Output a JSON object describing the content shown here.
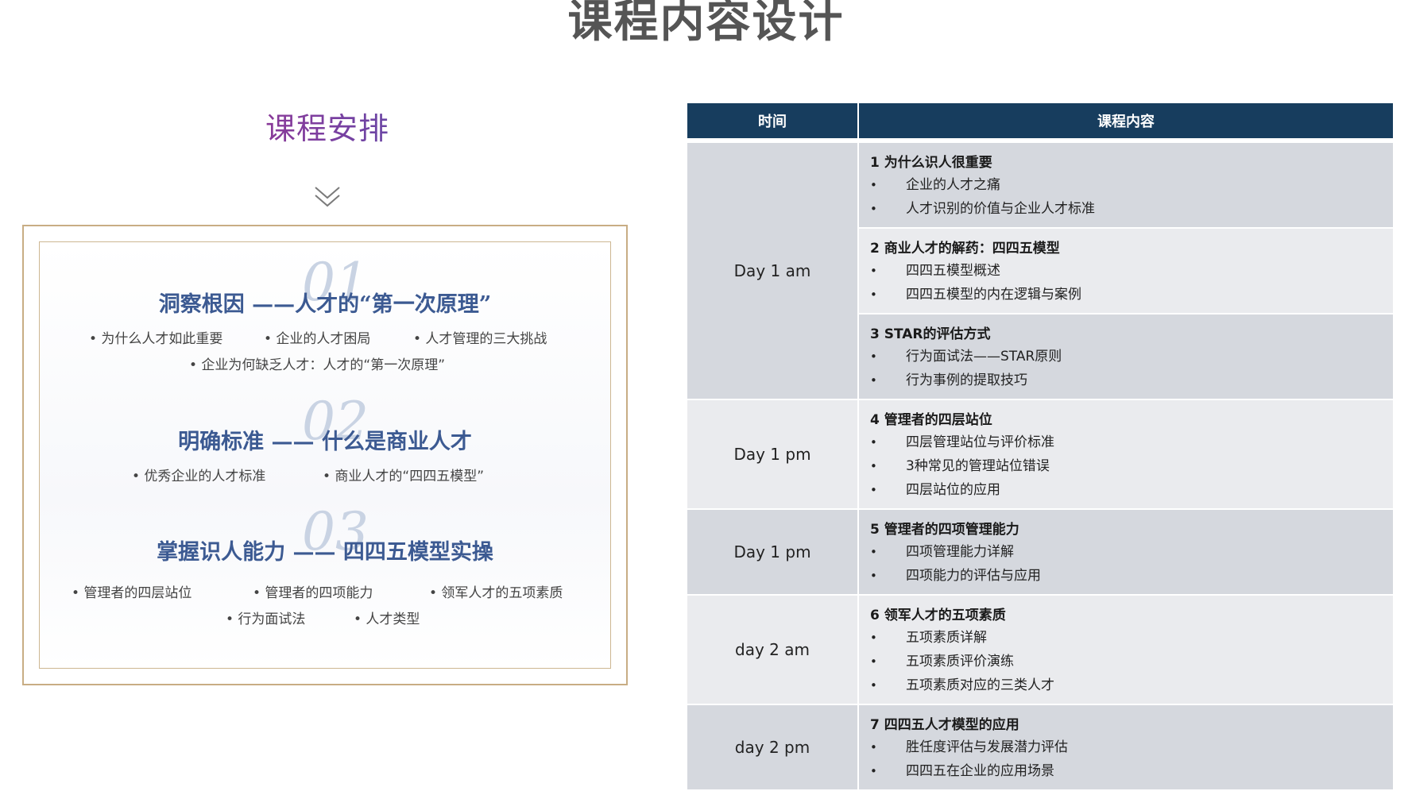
{
  "page": {
    "title": "课程内容设计"
  },
  "left": {
    "heading": "课程安排",
    "sections": [
      {
        "num": "01",
        "title": "洞察根因 ——人才的“第一次原理”",
        "bullets_row1": [
          "• 为什么人才如此重要",
          "• 企业的人才困局",
          "• 人才管理的三大挑战"
        ],
        "bullets_row2": [
          "• 企业为何缺乏人才：人才的“第一次原理”"
        ]
      },
      {
        "num": "02",
        "title": "明确标准 —— 什么是商业人才",
        "bullets_row1": [
          "• 优秀企业的人才标准",
          "• 商业人才的“四四五模型”"
        ],
        "bullets_row2": []
      },
      {
        "num": "03",
        "title": "掌握识人能力 —— 四四五模型实操",
        "bullets_row1": [
          "• 管理者的四层站位",
          "• 管理者的四项能力",
          "• 领军人才的五项素质"
        ],
        "bullets_row2": [
          "• 行为面试法",
          "• 人才类型"
        ]
      }
    ]
  },
  "table": {
    "headers": [
      "时间",
      "课程内容"
    ],
    "groups": [
      {
        "time": "Day 1 am",
        "topics": [
          {
            "title": "1 为什么识人很重要",
            "items": [
              "企业的人才之痛",
              "人才识别的价值与企业人才标准"
            ]
          },
          {
            "title": "2 商业人才的解药：四四五模型",
            "items": [
              "四四五模型概述",
              "四四五模型的内在逻辑与案例"
            ]
          },
          {
            "title": "3 STAR的评估方式",
            "items": [
              "行为面试法——STAR原则",
              "行为事例的提取技巧"
            ]
          }
        ]
      },
      {
        "time": "Day 1 pm",
        "topics": [
          {
            "title": "4 管理者的四层站位",
            "items": [
              "四层管理站位与评价标准",
              "3种常见的管理站位错误",
              "四层站位的应用"
            ]
          }
        ]
      },
      {
        "time": "Day 1 pm",
        "topics": [
          {
            "title": "5 管理者的四项管理能力",
            "items": [
              "四项管理能力详解",
              "四项能力的评估与应用"
            ]
          }
        ]
      },
      {
        "time": "day 2 am",
        "topics": [
          {
            "title": "6 领军人才的五项素质",
            "items": [
              "五项素质详解",
              "五项素质评价演练",
              "五项素质对应的三类人才"
            ]
          }
        ]
      },
      {
        "time": "day 2 pm",
        "topics": [
          {
            "title": "7 四四五人才模型的应用",
            "items": [
              "胜任度评估与发展潜力评估",
              "四四五在企业的应用场景"
            ]
          }
        ]
      }
    ]
  },
  "colors": {
    "header_bg": "#173d5e",
    "row_dark": "#d5d8de",
    "row_light": "#eaebee",
    "section_title": "#3c5a92",
    "frame": "#c8ad84"
  }
}
